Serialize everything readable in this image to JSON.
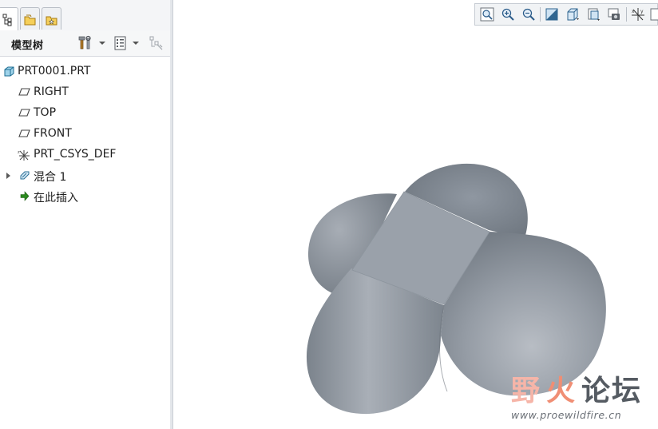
{
  "tabs": [
    {
      "icon": "model-tree-tab-icon"
    },
    {
      "icon": "folder-browser-tab-icon"
    },
    {
      "icon": "favorites-tab-icon"
    }
  ],
  "model_tree": {
    "title": "模型树",
    "toolbar_icons": [
      "settings-tools-icon",
      "show-options-icon",
      "filter-icon"
    ],
    "items": [
      {
        "label": "PRT0001.PRT",
        "icon": "part-icon"
      },
      {
        "label": "RIGHT",
        "icon": "datum-plane-icon"
      },
      {
        "label": "TOP",
        "icon": "datum-plane-icon"
      },
      {
        "label": "FRONT",
        "icon": "datum-plane-icon"
      },
      {
        "label": "PRT_CSYS_DEF",
        "icon": "coordinate-system-icon"
      },
      {
        "label": "混合 1",
        "icon": "blend-feature-icon"
      },
      {
        "label": "在此插入",
        "icon": "insert-here-arrow-icon"
      }
    ]
  },
  "view_toolbar": {
    "buttons": [
      "refit-icon",
      "zoom-in-icon",
      "zoom-out-icon",
      "reorient-icon",
      "saved-views-icon",
      "display-style-icon",
      "view-manager-icon",
      "datum-display-icon",
      "more-icon"
    ]
  },
  "watermark": {
    "ye": "野",
    "huo": "火",
    "luntan": "论坛",
    "url": "www.proewildfire.cn"
  },
  "colors": {
    "model_surface": "#8a929c",
    "model_top_face": "#9ea5ae",
    "selection_accent": "#f07a5c"
  }
}
